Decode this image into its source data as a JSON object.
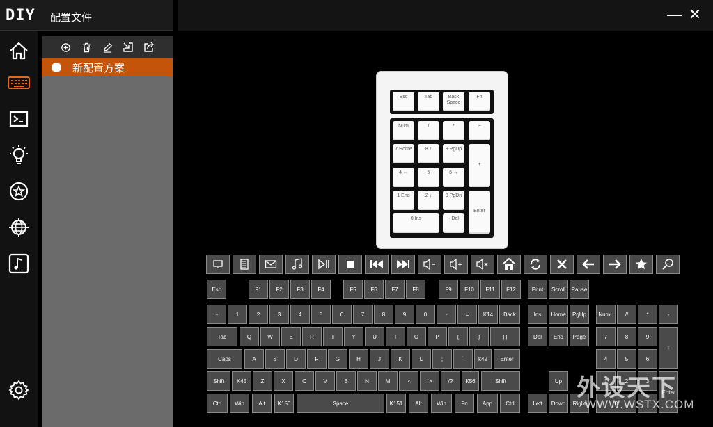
{
  "app": {
    "logo_text": "DIY",
    "title": "配置文件",
    "minimize_label": "—",
    "close_label": "✕"
  },
  "nav": [
    {
      "name": "home",
      "icon": "home-icon"
    },
    {
      "name": "keyboard",
      "icon": "keyboard-icon",
      "active": true
    },
    {
      "name": "macro",
      "icon": "terminal-icon"
    },
    {
      "name": "lighting",
      "icon": "lightbulb-icon"
    },
    {
      "name": "favorites",
      "icon": "star-icon"
    },
    {
      "name": "network",
      "icon": "globe-icon"
    },
    {
      "name": "music",
      "icon": "music-note-icon"
    },
    {
      "name": "settings",
      "icon": "gear-icon"
    }
  ],
  "profiles": {
    "toolbar": [
      "add-icon",
      "trash-icon",
      "edit-icon",
      "import-icon",
      "export-icon"
    ],
    "items": [
      {
        "name": "新配置方案",
        "selected": true
      }
    ]
  },
  "keypad": {
    "keys": [
      "Esc",
      "Tab",
      "Back Space",
      "Fn",
      "Num",
      "/",
      "*",
      "−",
      "7 Home",
      "8 ↑",
      "9 PgUp",
      "+",
      "4 ←",
      "5",
      "6 →",
      "1 End",
      "2 ↓",
      "3 PgDn",
      "Enter",
      "0 Ins",
      "· Del"
    ]
  },
  "function_keys": [
    "monitor-icon",
    "calculator-icon",
    "mail-icon",
    "music-icon",
    "play-pause-icon",
    "stop-icon",
    "previous-track-icon",
    "next-track-icon",
    "volume-down-icon",
    "volume-up-icon",
    "mute-icon",
    "home-icon",
    "refresh-icon",
    "close-icon",
    "back-arrow-icon",
    "forward-arrow-icon",
    "favorite-icon",
    "search-icon"
  ],
  "keyboard": {
    "row_f": [
      "Esc",
      "F1",
      "F2",
      "F3",
      "F4",
      "F5",
      "F6",
      "F7",
      "F8",
      "F9",
      "F10",
      "F11",
      "F12",
      "Print",
      "Scroll",
      "Pause"
    ],
    "row_num": [
      "~",
      "1",
      "2",
      "3",
      "4",
      "5",
      "6",
      "7",
      "8",
      "9",
      "0",
      "-",
      "=",
      "K14",
      "Back",
      "Ins",
      "Home",
      "PgUp",
      "NumL",
      "//",
      "*",
      "-"
    ],
    "row_tab": [
      "Tab",
      "Q",
      "W",
      "E",
      "R",
      "T",
      "Y",
      "U",
      "I",
      "O",
      "P",
      "[",
      "]",
      "| |",
      "Del",
      "End",
      "Page",
      "7",
      "8",
      "9",
      "+"
    ],
    "row_caps": [
      "Caps",
      "A",
      "S",
      "D",
      "F",
      "G",
      "H",
      "J",
      "K",
      "L",
      ";",
      "`",
      "k42",
      "Enter",
      "4",
      "5",
      "6"
    ],
    "row_shift": [
      "Shift",
      "K45",
      "Z",
      "X",
      "C",
      "V",
      "B",
      "N",
      "M",
      ",<",
      ".>",
      "/?",
      "K56",
      "Shift",
      "Up",
      "1",
      "2",
      "3",
      "Enter"
    ],
    "row_ctrl": [
      "Ctrl",
      "Win",
      "Alt",
      "K150",
      "Space",
      "K151",
      "Alt",
      "Win",
      "Fn",
      "App",
      "Ctrl",
      "Left",
      "Down",
      "Right",
      "0",
      "."
    ]
  },
  "watermark": {
    "big": "外设天下",
    "small": "WWW.WSTX.COM"
  }
}
